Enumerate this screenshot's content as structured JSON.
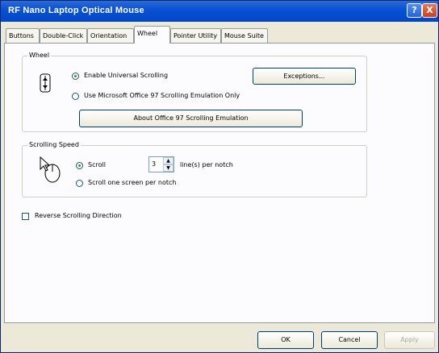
{
  "window": {
    "title": "RF Nano Laptop Optical Mouse",
    "help_glyph": "?",
    "close_glyph": "X"
  },
  "tabs": [
    "Buttons",
    "Double-Click",
    "Orientation",
    "Wheel",
    "Pointer Utility",
    "Mouse Suite"
  ],
  "wheel_group": {
    "label": "Wheel",
    "enable_universal_scrolling": "Enable Universal Scrolling",
    "enable_checked": true,
    "exceptions_button": "Exceptions...",
    "use_office97": "Use Microsoft Office 97 Scrolling Emulation Only",
    "office97_checked": false,
    "about_button": "About Office 97 Scrolling Emulation"
  },
  "speed_group": {
    "label": "Scrolling Speed",
    "scroll_option": "Scroll",
    "lines_value": "3",
    "lines_suffix": "line(s) per notch",
    "one_screen_option": "Scroll one screen per notch",
    "selected": "lines"
  },
  "reverse": {
    "label": "Reverse Scrolling Direction",
    "checked": false
  },
  "footer": {
    "ok": "OK",
    "cancel": "Cancel",
    "apply": "Apply"
  }
}
